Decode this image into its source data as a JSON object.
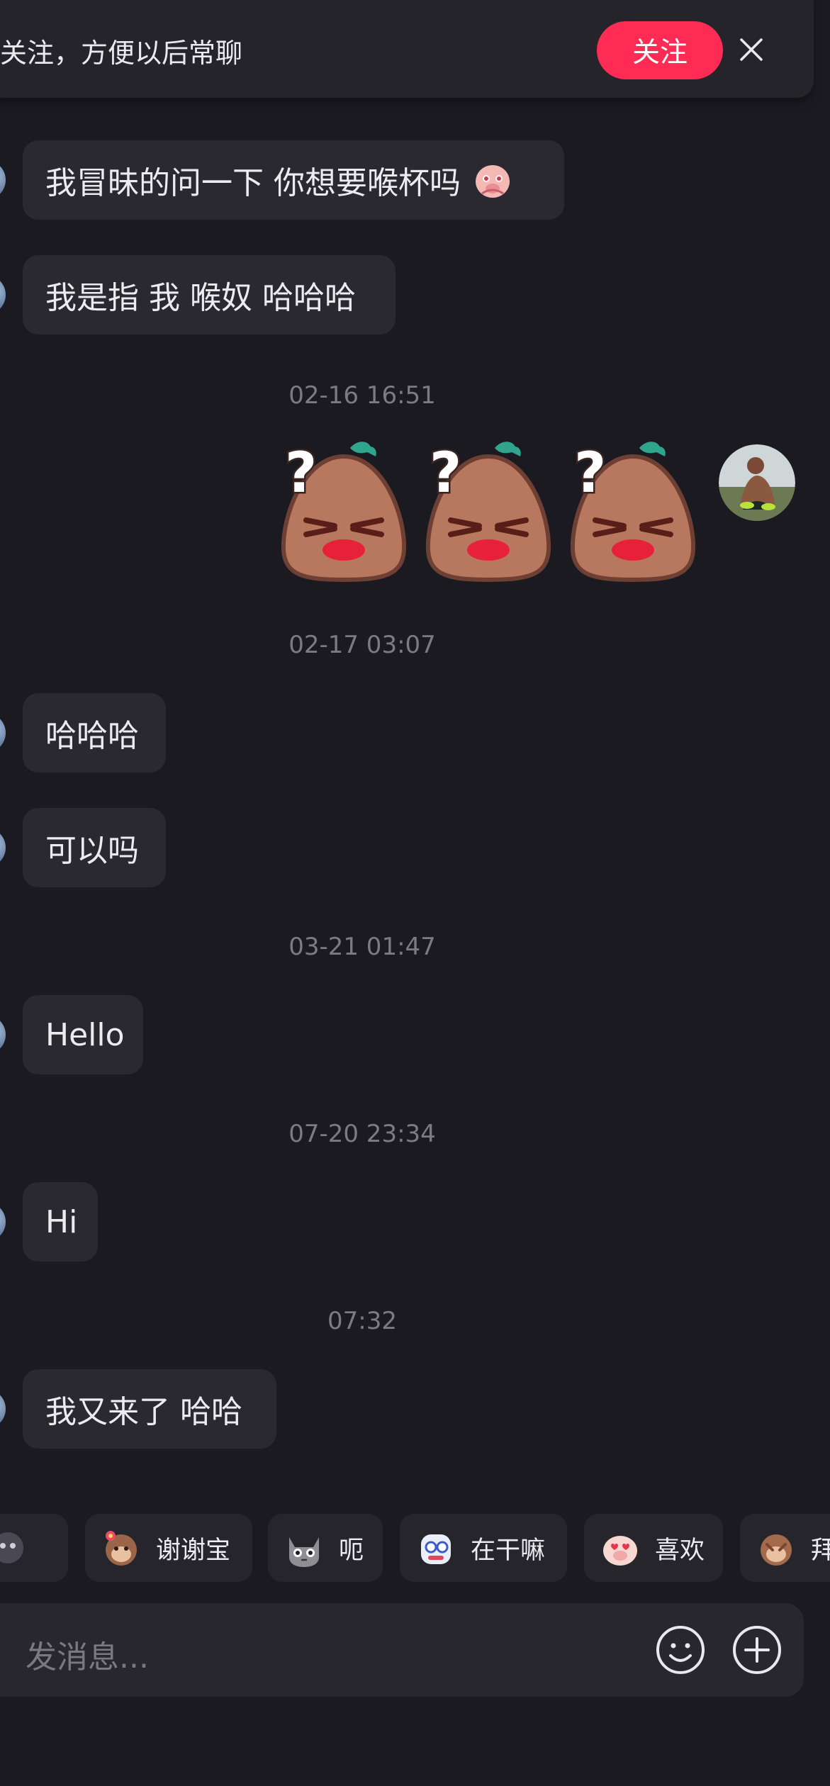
{
  "banner": {
    "text": "关注，方便以后常聊",
    "follow_label": "关注",
    "close_icon": "close-icon"
  },
  "messages": [
    {
      "text": "我冒昧的问一下 你想要喉杯吗",
      "emoji": "blushing-pig-emoji"
    },
    {
      "text": "我是指 我 喉奴 哈哈哈"
    },
    {
      "text": "哈哈哈"
    },
    {
      "text": "可以吗"
    },
    {
      "text": "Hello"
    },
    {
      "text": "Hi"
    },
    {
      "text": "我又来了 哈哈"
    }
  ],
  "timestamps": [
    "02-16 16:51",
    "02-17 03:07",
    "03-21 01:47",
    "07-20 23:34",
    "07:32"
  ],
  "stickers": {
    "count_shown": 3,
    "icon": "confused-potato-sticker"
  },
  "quick_replies": [
    {
      "label": "",
      "icon": "partial-sticker-icon"
    },
    {
      "label": "谢谢宝",
      "icon": "monkey-flower-icon"
    },
    {
      "label": "呃",
      "icon": "grey-cat-icon"
    },
    {
      "label": "在干嘛",
      "icon": "robot-face-icon"
    },
    {
      "label": "喜欢",
      "icon": "pig-love-icon"
    },
    {
      "label": "拜",
      "icon": "monkey-bow-icon"
    }
  ],
  "input": {
    "placeholder": "发消息...",
    "emoji_icon": "smile-icon",
    "add_icon": "plus-circle-icon"
  },
  "colors": {
    "background": "#1b1a20",
    "bubble": "#2a2930",
    "accent": "#fe2c55",
    "timestamp": "#7c7b85"
  }
}
